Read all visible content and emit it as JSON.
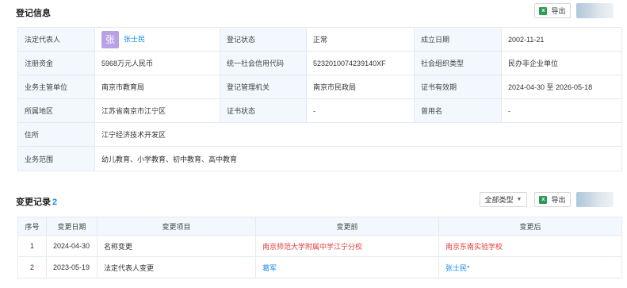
{
  "reg": {
    "title": "登记信息",
    "export_label": "导出",
    "rows": [
      [
        {
          "label": "法定代表人",
          "value": "张士民",
          "avatar": "张"
        },
        {
          "label": "登记状态",
          "value": "正常"
        },
        {
          "label": "成立日期",
          "value": "2002-11-21"
        }
      ],
      [
        {
          "label": "注册资金",
          "value": "5968万元人民币"
        },
        {
          "label": "统一社会信用代码",
          "value": "5232010074239140XF"
        },
        {
          "label": "社会组织类型",
          "value": "民办非企业单位"
        }
      ],
      [
        {
          "label": "业务主管单位",
          "value": "南京市教育局"
        },
        {
          "label": "登记管理机关",
          "value": "南京市民政局"
        },
        {
          "label": "证书有效期",
          "value": "2024-04-30 至 2026-05-18"
        }
      ],
      [
        {
          "label": "所属地区",
          "value": "江苏省南京市江宁区"
        },
        {
          "label": "证书状态",
          "value": "-"
        },
        {
          "label": "曾用名",
          "value": "-"
        }
      ]
    ],
    "address_label": "住所",
    "address_value": "江宁经济技术开发区",
    "scope_label": "业务范围",
    "scope_value": "幼儿教育、小学教育、初中教育、高中教育"
  },
  "changes": {
    "title": "变更记录",
    "count": "2",
    "filter_label": "全部类型",
    "export_label": "导出",
    "headers": [
      "序号",
      "变更日期",
      "变更项目",
      "变更前",
      "变更后"
    ],
    "rows": [
      {
        "no": "1",
        "date": "2024-04-30",
        "item": "名称变更",
        "before": "南京师范大学附属中学江宁分校",
        "after": "南京东南实验学校"
      },
      {
        "no": "2",
        "date": "2023-05-19",
        "item": "法定代表人变更",
        "before": "葛军",
        "after": "张士民*"
      }
    ]
  },
  "colors": {
    "accent": "#128bed",
    "label_bg": "#f2f8fd",
    "red": "#e33b3b",
    "avatar": "#b9a1e6"
  }
}
